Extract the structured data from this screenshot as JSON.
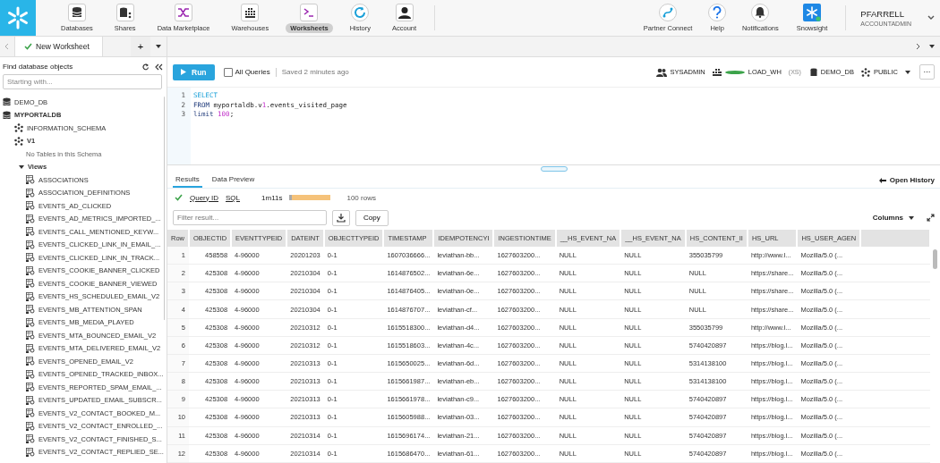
{
  "nav": {
    "items": [
      {
        "label": "Databases",
        "selected": false
      },
      {
        "label": "Shares",
        "selected": false
      },
      {
        "label": "Data Marketplace",
        "selected": false
      },
      {
        "label": "Warehouses",
        "selected": false
      },
      {
        "label": "Worksheets",
        "selected": true
      },
      {
        "label": "History",
        "selected": false
      },
      {
        "label": "Account",
        "selected": false
      }
    ],
    "right_items": [
      {
        "label": "Partner Connect"
      },
      {
        "label": "Help"
      },
      {
        "label": "Notifications"
      },
      {
        "label": "Snowsight"
      }
    ],
    "user": {
      "name": "PFARRELL",
      "role": "ACCOUNTADMIN"
    }
  },
  "worksheet_tabs": [
    {
      "label": "New Worksheet",
      "selected": true
    }
  ],
  "add_tab": "+",
  "sidebar": {
    "title": "Find database objects",
    "search": {
      "placeholder": "Starting with..."
    },
    "databases": [
      {
        "name": "DEMO_DB",
        "expanded": false
      },
      {
        "name": "MYPORTALDB",
        "expanded": true,
        "schemas": [
          {
            "name": "INFORMATION_SCHEMA",
            "expanded": false
          },
          {
            "name": "V1",
            "expanded": true,
            "note": "No Tables in this Schema",
            "folders": [
              {
                "label": "Views",
                "expanded": true,
                "children": [
                  "ASSOCIATIONS",
                  "ASSOCIATION_DEFINITIONS",
                  "EVENTS_AD_CLICKED",
                  "EVENTS_AD_METRICS_IMPORTED_...",
                  "EVENTS_CALL_MENTIONED_KEYW...",
                  "EVENTS_CLICKED_LINK_IN_EMAIL_...",
                  "EVENTS_CLICKED_LINK_IN_TRACK...",
                  "EVENTS_COOKIE_BANNER_CLICKED",
                  "EVENTS_COOKIE_BANNER_VIEWED",
                  "EVENTS_HS_SCHEDULED_EMAIL_V2",
                  "EVENTS_MB_ATTENTION_SPAN",
                  "EVENTS_MB_MEDIA_PLAYED",
                  "EVENTS_MTA_BOUNCED_EMAIL_V2",
                  "EVENTS_MTA_DELIVERED_EMAIL_V2",
                  "EVENTS_OPENED_EMAIL_V2",
                  "EVENTS_OPENED_TRACKED_INBOX...",
                  "EVENTS_REPORTED_SPAM_EMAIL_...",
                  "EVENTS_UPDATED_EMAIL_SUBSCR...",
                  "EVENTS_V2_CONTACT_BOOKED_M...",
                  "EVENTS_V2_CONTACT_ENROLLED_...",
                  "EVENTS_V2_CONTACT_FINISHED_S...",
                  "EVENTS_V2_CONTACT_REPLIED_SE..."
                ]
              }
            ]
          }
        ]
      }
    ]
  },
  "toolbar": {
    "run": "Run",
    "all_queries": {
      "label": "All Queries",
      "checked": false
    },
    "saved": "Saved 2 minutes ago",
    "role": "SYSADMIN",
    "warehouse": {
      "name": "LOAD_WH",
      "size": "(XS)",
      "running": true
    },
    "database": "DEMO_DB",
    "schema": "PUBLIC",
    "more": "···"
  },
  "editor": {
    "lines": [
      {
        "number": "1",
        "tokens": [
          {
            "text": "SELECT",
            "kind": "keyword"
          }
        ]
      },
      {
        "number": "2",
        "tokens": [
          {
            "text": "FROM",
            "kind": "keyword2"
          },
          {
            "text": " myportaldb.v",
            "kind": "plain"
          },
          {
            "text": "1",
            "kind": "number"
          },
          {
            "text": ".events_visited_page",
            "kind": "plain"
          }
        ]
      },
      {
        "number": "3",
        "tokens": [
          {
            "text": "limit ",
            "kind": "keyword2"
          },
          {
            "text": "100",
            "kind": "number"
          },
          {
            "text": ";",
            "kind": "plain"
          }
        ]
      }
    ]
  },
  "results": {
    "tabs": [
      {
        "label": "Results",
        "selected": true
      },
      {
        "label": "Data Preview",
        "selected": false
      }
    ],
    "open_history": "Open History",
    "query_id": "Query ID",
    "sql": "SQL",
    "duration": "1m11s",
    "row_count": "100 rows",
    "filter": {
      "placeholder": "Filter result..."
    },
    "copy": "Copy",
    "columns_button": "Columns",
    "table": {
      "columns": [
        "Row",
        "OBJECTID",
        "EVENTTYPEID",
        "DATEINT",
        "OBJECTTYPEID",
        "TIMESTAMP",
        "IDEMPOTENCYI",
        "INGESTIONTIME",
        "__HS_EVENT_NA",
        "__HS_EVENT_NA",
        "HS_CONTENT_II",
        "HS_URL",
        "HS_USER_AGEN"
      ],
      "rows": [
        [
          "1",
          "458558",
          "4-96000",
          "20201203",
          "0-1",
          "1607036666...",
          "leviathan-bb...",
          "1627603200...",
          "NULL",
          "NULL",
          "355035799",
          "http://www.l...",
          "Mozilla/5.0 (..."
        ],
        [
          "2",
          "425308",
          "4-96000",
          "20210304",
          "0-1",
          "1614876502...",
          "leviathan-6e...",
          "1627603200...",
          "NULL",
          "NULL",
          "NULL",
          "https://share...",
          "Mozilla/5.0 (..."
        ],
        [
          "3",
          "425308",
          "4-96000",
          "20210304",
          "0-1",
          "1614876405...",
          "leviathan-0e...",
          "1627603200...",
          "NULL",
          "NULL",
          "NULL",
          "https://share...",
          "Mozilla/5.0 (..."
        ],
        [
          "4",
          "425308",
          "4-96000",
          "20210304",
          "0-1",
          "1614876707...",
          "leviathan-cf...",
          "1627603200...",
          "NULL",
          "NULL",
          "NULL",
          "https://share...",
          "Mozilla/5.0 (..."
        ],
        [
          "5",
          "425308",
          "4-96000",
          "20210312",
          "0-1",
          "1615518300...",
          "leviathan-d4...",
          "1627603200...",
          "NULL",
          "NULL",
          "355035799",
          "http://www.l...",
          "Mozilla/5.0 (..."
        ],
        [
          "6",
          "425308",
          "4-96000",
          "20210312",
          "0-1",
          "1615518603...",
          "leviathan-4c...",
          "1627603200...",
          "NULL",
          "NULL",
          "5740420897",
          "https://blog.l...",
          "Mozilla/5.0 (..."
        ],
        [
          "7",
          "425308",
          "4-96000",
          "20210313",
          "0-1",
          "1615650025...",
          "leviathan-6d...",
          "1627603200...",
          "NULL",
          "NULL",
          "5314138100",
          "https://blog.l...",
          "Mozilla/5.0 (..."
        ],
        [
          "8",
          "425308",
          "4-96000",
          "20210313",
          "0-1",
          "1615661987...",
          "leviathan-eb...",
          "1627603200...",
          "NULL",
          "NULL",
          "5314138100",
          "https://blog.l...",
          "Mozilla/5.0 (..."
        ],
        [
          "9",
          "425308",
          "4-96000",
          "20210313",
          "0-1",
          "1615661978...",
          "leviathan-c9...",
          "1627603200...",
          "NULL",
          "NULL",
          "5740420897",
          "https://blog.l...",
          "Mozilla/5.0 (..."
        ],
        [
          "10",
          "425308",
          "4-96000",
          "20210313",
          "0-1",
          "1615605988...",
          "leviathan-03...",
          "1627603200...",
          "NULL",
          "NULL",
          "5740420897",
          "https://blog.l...",
          "Mozilla/5.0 (..."
        ],
        [
          "11",
          "425308",
          "4-96000",
          "20210314",
          "0-1",
          "1615696174...",
          "leviathan-21...",
          "1627603200...",
          "NULL",
          "NULL",
          "5740420897",
          "https://blog.l...",
          "Mozilla/5.0 (..."
        ],
        [
          "12",
          "425308",
          "4-96000",
          "20210314",
          "0-1",
          "1615686470...",
          "leviathan-61...",
          "1627603200...",
          "NULL",
          "NULL",
          "5740420897",
          "https://blog.l...",
          "Mozilla/5.0 (..."
        ]
      ]
    }
  }
}
